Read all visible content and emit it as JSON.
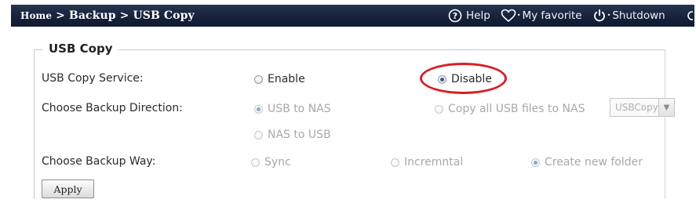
{
  "header": {
    "breadcrumb": {
      "home": "Home",
      "separator_1": ">",
      "backup": "Backup",
      "separator_2": ">",
      "current": "USB Copy"
    },
    "help_label": "Help",
    "favorite_label": "My favorite",
    "shutdown_label": "Shutdown",
    "icons": [
      "help-icon",
      "heart-icon",
      "power-icon"
    ]
  },
  "section": {
    "title": "USB Copy"
  },
  "service": {
    "label": "USB Copy Service:",
    "options": [
      {
        "label": "Enable",
        "selected": false
      },
      {
        "label": "Disable",
        "selected": true
      }
    ],
    "highlight_color": "#d81e24"
  },
  "direction": {
    "label": "Choose Backup Direction:",
    "options": [
      {
        "label": "USB to NAS",
        "selected": true
      },
      {
        "label": "Copy all USB files to NAS",
        "selected": false
      },
      {
        "label": "NAS to USB",
        "selected": false
      }
    ],
    "folder_select": {
      "value": "USBCopy"
    }
  },
  "way": {
    "label": "Choose Backup Way:",
    "options": [
      {
        "label": "Sync",
        "selected": false
      },
      {
        "label": "Incremntal",
        "selected": false
      },
      {
        "label": "Create new folder",
        "selected": true
      }
    ]
  },
  "apply_label": "Apply",
  "colors": {
    "header_bg": "#16213a",
    "accent": "#2a5ea8",
    "highlight": "#d81e24"
  }
}
